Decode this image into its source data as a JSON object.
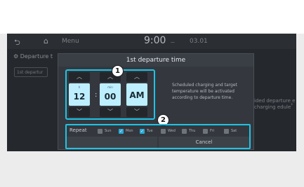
{
  "statusbar": {
    "menu_label": "Menu",
    "clock": "9:00",
    "date": "03.01"
  },
  "background": {
    "title": "Departure t",
    "item": "1st departur",
    "description": "ided departure e charging edule"
  },
  "dialog": {
    "title": "1st departure time",
    "description": "Scheduled charging and target temperature will be activated according to departure time.",
    "hour": {
      "caption": "h",
      "value": "12"
    },
    "minute": {
      "caption": "min",
      "value": "00"
    },
    "period": {
      "caption": "",
      "value": "AM"
    },
    "separator": ":",
    "repeat_label": "Repeat",
    "days": [
      {
        "name": "Sun",
        "checked": false
      },
      {
        "name": "Mon",
        "checked": true
      },
      {
        "name": "Tue",
        "checked": true
      },
      {
        "name": "Wed",
        "checked": false
      },
      {
        "name": "Thu",
        "checked": false
      },
      {
        "name": "Fri",
        "checked": false
      },
      {
        "name": "Sat",
        "checked": false
      }
    ],
    "ok_label": "",
    "cancel_label": "Cancel"
  },
  "callouts": {
    "one": "1",
    "two": "2"
  },
  "colors": {
    "highlight": "#1ec4e6",
    "checked": "#2aa9d6"
  }
}
